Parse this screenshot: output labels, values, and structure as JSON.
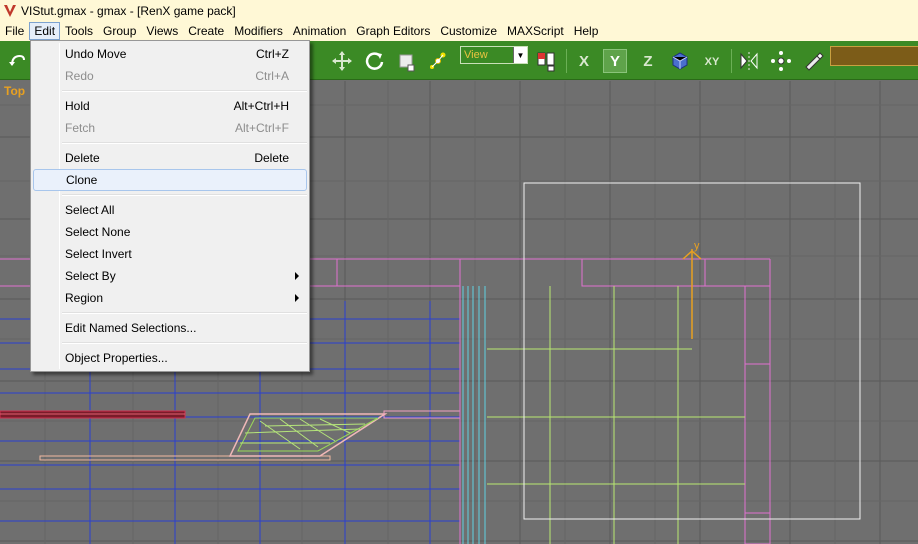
{
  "window": {
    "title": "VIStut.gmax - gmax - [RenX game pack]"
  },
  "menubar": {
    "items": [
      "File",
      "Edit",
      "Tools",
      "Group",
      "Views",
      "Create",
      "Modifiers",
      "Animation",
      "Graph Editors",
      "Customize",
      "MAXScript",
      "Help"
    ],
    "active": "Edit"
  },
  "toolbar": {
    "view_select": "View",
    "axis_x": "X",
    "axis_y": "Y",
    "axis_z": "Z",
    "axis_xy": "XY",
    "accent": "#3b8a25"
  },
  "viewport": {
    "label": "Top",
    "axis_label": "y"
  },
  "edit_menu": {
    "items": [
      {
        "label": "Undo Move",
        "shortcut": "Ctrl+Z",
        "disabled": false
      },
      {
        "label": "Redo",
        "shortcut": "Ctrl+A",
        "disabled": true
      },
      {
        "label": "Hold",
        "shortcut": "Alt+Ctrl+H",
        "disabled": false
      },
      {
        "label": "Fetch",
        "shortcut": "Alt+Ctrl+F",
        "disabled": true
      },
      {
        "label": "Delete",
        "shortcut": "Delete",
        "disabled": false
      },
      {
        "label": "Clone",
        "shortcut": "",
        "disabled": false,
        "highlighted": true
      },
      {
        "label": "Select All",
        "shortcut": ""
      },
      {
        "label": "Select None",
        "shortcut": ""
      },
      {
        "label": "Select Invert",
        "shortcut": ""
      },
      {
        "label": "Select By",
        "shortcut": "",
        "submenu": true
      },
      {
        "label": "Region",
        "shortcut": "",
        "submenu": true
      },
      {
        "label": "Edit Named Selections...",
        "shortcut": ""
      },
      {
        "label": "Object Properties...",
        "shortcut": ""
      }
    ]
  }
}
